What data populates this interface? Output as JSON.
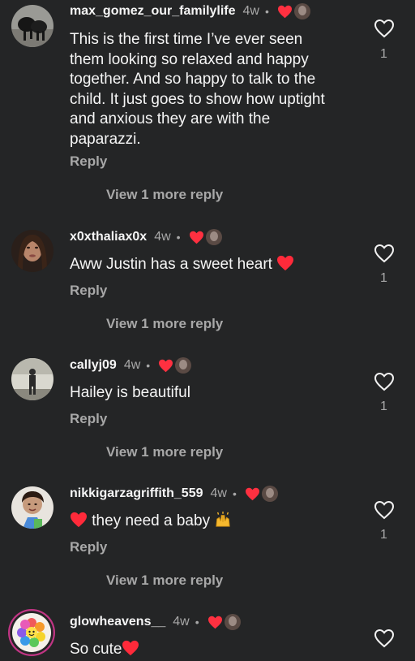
{
  "colors": {
    "background": "#242526",
    "like_red": "#ff3040",
    "secondary": "#a8a8a8"
  },
  "comments": [
    {
      "username": "max_gomez_our_familylife",
      "time": "4w",
      "text": "This is the first time I’ve ever seen them looking so relaxed and happy together. And so happy to talk to the child. It just goes to show how uptight and anxious they are with the paparazzi.",
      "reply": "Reply",
      "view_more": "View 1 more reply",
      "likes": "1",
      "creator_liked": true
    },
    {
      "username": "x0xthaliax0x",
      "time": "4w",
      "text": "Aww Justin has a sweet heart",
      "text_emoji": "heart-emoji",
      "reply": "Reply",
      "view_more": "View 1 more reply",
      "likes": "1",
      "creator_liked": true
    },
    {
      "username": "callyj09",
      "time": "4w",
      "text": "Hailey is beautiful",
      "reply": "Reply",
      "view_more": "View 1 more reply",
      "likes": "1",
      "creator_liked": true
    },
    {
      "username": "nikkigarzagriffith_559",
      "time": "4w",
      "text": "they need a baby",
      "text_emoji_before": "heart-emoji",
      "text_emoji_after": "raising-hands-emoji",
      "reply": "Reply",
      "view_more": "View 1 more reply",
      "likes": "1",
      "creator_liked": true
    },
    {
      "username": "glowheavens__",
      "time": "4w",
      "text": "So cute",
      "text_emoji": "heart-emoji",
      "creator_liked": true
    }
  ],
  "separator": "•"
}
